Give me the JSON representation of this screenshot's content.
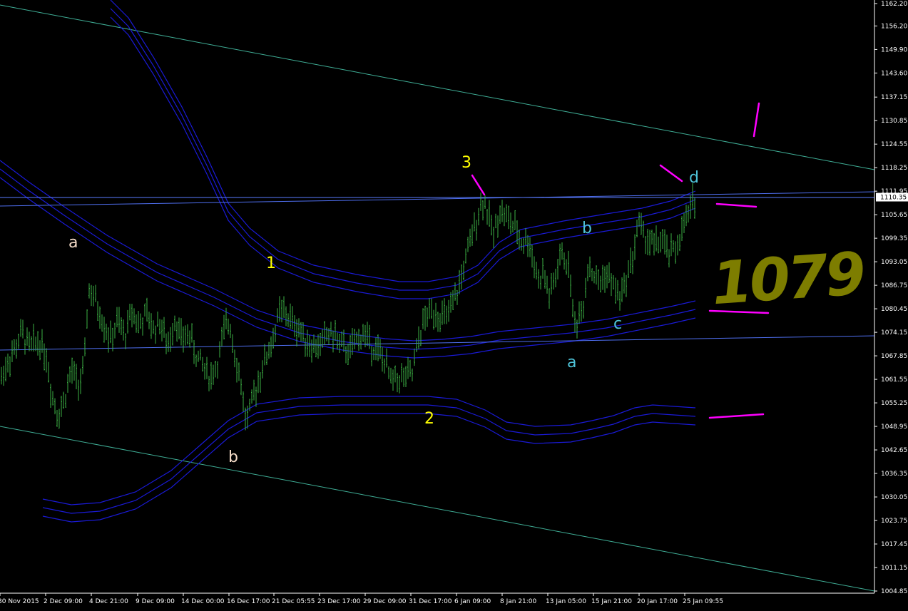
{
  "chart_data": {
    "type": "ohlc",
    "instrument_hint": "",
    "price_axis": {
      "ticks": [
        "1162.20",
        "1156.20",
        "1149.90",
        "1143.60",
        "1137.15",
        "1130.85",
        "1124.55",
        "1118.25",
        "1111.95",
        "1105.65",
        "1099.35",
        "1093.05",
        "1086.75",
        "1080.45",
        "1074.15",
        "1067.85",
        "1061.55",
        "1055.25",
        "1048.95",
        "1042.65",
        "1036.35",
        "1030.05",
        "1023.75",
        "1017.45",
        "1011.15",
        "1004.85"
      ],
      "current_price": "1110.35",
      "range": [
        1004.85,
        1162.2
      ]
    },
    "time_axis": {
      "ticks": [
        "30 Nov 2015",
        "2 Dec 09:00",
        "4 Dec 21:00",
        "9 Dec 09:00",
        "14 Dec 00:00",
        "16 Dec 17:00",
        "21 Dec 05:55",
        "23 Dec 17:00",
        "29 Dec 09:00",
        "31 Dec 17:00",
        "6 Jan 09:00",
        "8 Jan 21:00",
        "13 Jan 05:00",
        "15 Jan 21:00",
        "20 Jan 17:00",
        "25 Jan 09:55"
      ]
    },
    "price_path": [
      [
        0,
        1061
      ],
      [
        10,
        1066
      ],
      [
        22,
        1070
      ],
      [
        30,
        1074
      ],
      [
        42,
        1070
      ],
      [
        55,
        1072
      ],
      [
        65,
        1068
      ],
      [
        72,
        1058
      ],
      [
        82,
        1052
      ],
      [
        90,
        1056
      ],
      [
        100,
        1064
      ],
      [
        110,
        1060
      ],
      [
        118,
        1064
      ],
      [
        124,
        1086
      ],
      [
        135,
        1082
      ],
      [
        145,
        1077
      ],
      [
        155,
        1072
      ],
      [
        165,
        1077
      ],
      [
        175,
        1073
      ],
      [
        185,
        1080
      ],
      [
        195,
        1076
      ],
      [
        205,
        1079
      ],
      [
        215,
        1075
      ],
      [
        225,
        1077
      ],
      [
        235,
        1070
      ],
      [
        245,
        1078
      ],
      [
        255,
        1072
      ],
      [
        265,
        1074
      ],
      [
        275,
        1068
      ],
      [
        285,
        1065
      ],
      [
        295,
        1062
      ],
      [
        305,
        1066
      ],
      [
        315,
        1075
      ],
      [
        322,
        1077
      ],
      [
        330,
        1068
      ],
      [
        338,
        1060
      ],
      [
        345,
        1050
      ],
      [
        352,
        1054
      ],
      [
        360,
        1060
      ],
      [
        370,
        1066
      ],
      [
        378,
        1070
      ],
      [
        385,
        1074
      ],
      [
        393,
        1080
      ],
      [
        400,
        1079
      ],
      [
        410,
        1077
      ],
      [
        420,
        1075
      ],
      [
        430,
        1072
      ],
      [
        440,
        1070
      ],
      [
        450,
        1071
      ],
      [
        460,
        1074
      ],
      [
        470,
        1073
      ],
      [
        480,
        1070
      ],
      [
        490,
        1069
      ],
      [
        500,
        1072
      ],
      [
        510,
        1074
      ],
      [
        520,
        1071
      ],
      [
        530,
        1069
      ],
      [
        540,
        1066
      ],
      [
        548,
        1061
      ],
      [
        558,
        1062
      ],
      [
        568,
        1062
      ],
      [
        578,
        1063
      ],
      [
        585,
        1070
      ],
      [
        592,
        1076
      ],
      [
        600,
        1079
      ],
      [
        610,
        1080
      ],
      [
        620,
        1078
      ],
      [
        630,
        1079
      ],
      [
        640,
        1084
      ],
      [
        648,
        1090
      ],
      [
        655,
        1095
      ],
      [
        662,
        1100
      ],
      [
        670,
        1106
      ],
      [
        678,
        1110
      ],
      [
        685,
        1105
      ],
      [
        692,
        1100
      ],
      [
        700,
        1107
      ],
      [
        710,
        1105
      ],
      [
        718,
        1103
      ],
      [
        725,
        1101
      ],
      [
        732,
        1098
      ],
      [
        740,
        1099
      ],
      [
        748,
        1094
      ],
      [
        755,
        1088
      ],
      [
        762,
        1090
      ],
      [
        770,
        1084
      ],
      [
        778,
        1088
      ],
      [
        786,
        1095
      ],
      [
        795,
        1093
      ],
      [
        800,
        1088
      ],
      [
        805,
        1075
      ],
      [
        812,
        1079
      ],
      [
        818,
        1082
      ],
      [
        824,
        1092
      ],
      [
        832,
        1090
      ],
      [
        840,
        1087
      ],
      [
        848,
        1090
      ],
      [
        856,
        1088
      ],
      [
        864,
        1085
      ],
      [
        872,
        1084
      ],
      [
        880,
        1090
      ],
      [
        888,
        1095
      ],
      [
        895,
        1104
      ],
      [
        902,
        1100
      ],
      [
        910,
        1099
      ],
      [
        918,
        1097
      ],
      [
        926,
        1099
      ],
      [
        934,
        1096
      ],
      [
        942,
        1095
      ],
      [
        950,
        1098
      ],
      [
        958,
        1102
      ],
      [
        966,
        1106
      ],
      [
        974,
        1110
      ]
    ],
    "wave_labels": [
      {
        "text": "a",
        "color": "#f5dcc8",
        "x": "30 Nov–2 Dec",
        "price": 1098
      },
      {
        "text": "1",
        "color": "#ffff00",
        "x": "18 Dec",
        "price": 1091
      },
      {
        "text": "b",
        "color": "#f5dcc8",
        "x": "16 Dec",
        "price": 1039
      },
      {
        "text": "2",
        "color": "#ffff00",
        "x": "30 Dec",
        "price": 1050
      },
      {
        "text": "3",
        "color": "#ffff00",
        "x": "4 Jan",
        "price": 1118
      },
      {
        "text": "a",
        "color": "#4ec3d8",
        "x": "12 Jan",
        "price": 1062
      },
      {
        "text": "b",
        "color": "#4ec3d8",
        "x": "13 Jan",
        "price": 1102
      },
      {
        "text": "c",
        "color": "#4ec3d8",
        "x": "18 Jan",
        "price": 1074
      },
      {
        "text": "d",
        "color": "#4ec3d8",
        "x": "24 Jan",
        "price": 1114
      }
    ],
    "annotation_mark": "1079",
    "colors": {
      "background": "#000000",
      "bars": "#3cb043",
      "envelopes": "#1a1ad6",
      "channel": "#3fae96",
      "horizontal_lines": "#4f6ff0",
      "markers": "#ff00ff",
      "axis": "#ffffff"
    }
  }
}
